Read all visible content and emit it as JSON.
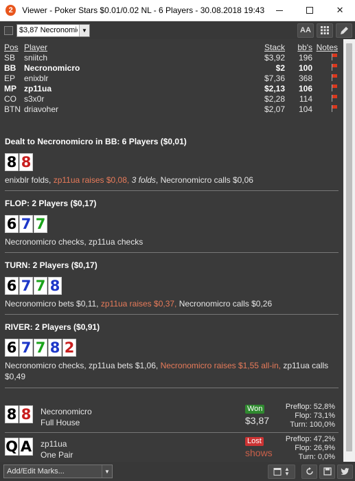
{
  "window": {
    "title": "Viewer - Poker Stars $0.01/0.02 NL - 6 Players - 30.08.2018 19:43",
    "app_icon_glyph": "2",
    "min_label": "",
    "max_label": "",
    "close_label": "✕"
  },
  "toolbar": {
    "hand_select_value": "$3,87 Necronomicro",
    "font_button": "AA",
    "grid_icon": "grid-icon",
    "edit_icon": "pencil-icon"
  },
  "players_table": {
    "headers": {
      "pos": "Pos",
      "player": "Player",
      "stack": "Stack",
      "bbs": "bb's",
      "notes": "Notes"
    },
    "rows": [
      {
        "pos": "SB",
        "player": "sniitch",
        "stack": "$3,92",
        "bbs": "196"
      },
      {
        "pos": "BB",
        "player": "Necronomicro",
        "stack": "$2",
        "bbs": "100"
      },
      {
        "pos": "EP",
        "player": "enixblr",
        "stack": "$7,36",
        "bbs": "368"
      },
      {
        "pos": "MP",
        "player": "zp11ua",
        "stack": "$2,13",
        "bbs": "106"
      },
      {
        "pos": "CO",
        "player": "s3x0r",
        "stack": "$2,28",
        "bbs": "114"
      },
      {
        "pos": "BTN",
        "player": "driaνoher",
        "stack": "$2,07",
        "bbs": "104"
      }
    ]
  },
  "preflop": {
    "title": "Dealt to Necronomicro in BB: 6 Players ($0,01)",
    "cards": [
      "8",
      "8"
    ],
    "action_1": "enixblr folds, ",
    "action_2": "zp11ua raises $0,08, ",
    "action_3": "3 folds",
    "action_4": ", Necronomicro calls $0,06"
  },
  "flop": {
    "title": "FLOP: 2 Players ($0,17)",
    "cards": [
      "6",
      "7",
      "7"
    ],
    "action": "Necronomicro checks, zp11ua checks"
  },
  "turn": {
    "title": "TURN: 2 Players ($0,17)",
    "cards": [
      "6",
      "7",
      "7",
      "8"
    ],
    "action_1": "Necronomicro bets $0,11, ",
    "action_2": "zp11ua raises $0,37, ",
    "action_3": "Necronomicro calls $0,26"
  },
  "river": {
    "title": "RIVER: 2 Players ($0,91)",
    "cards": [
      "6",
      "7",
      "7",
      "8",
      "2"
    ],
    "action_1": "Necronomicro checks, zp11ua bets $1,06, ",
    "action_2": "Necronomicro raises $1,55 all-in, ",
    "action_3": "zp11ua calls",
    "action_4": "$0,49"
  },
  "results": [
    {
      "cards": [
        "8",
        "8"
      ],
      "name": "Necronomicro",
      "hand": "Full House",
      "badge": "Won",
      "amount": "$3,87",
      "preflop_label": "Preflop:",
      "preflop": "52,8%",
      "flop_label": "Flop:",
      "flop": "73,1%",
      "turn_label": "Turn:",
      "turn": "100,0%"
    },
    {
      "cards": [
        "Q",
        "A"
      ],
      "name": "zp11ua",
      "hand": "One Pair",
      "badge": "Lost",
      "amount": "shows",
      "preflop_label": "Preflop:",
      "preflop": "47,2%",
      "flop_label": "Flop:",
      "flop": "26,9%",
      "turn_label": "Turn:",
      "turn": "0,0%"
    }
  ],
  "statusbar": {
    "marks_select": "Add/Edit Marks...",
    "icons": [
      "calendar-icon",
      "refresh-icon",
      "save-icon",
      "twitter-icon"
    ]
  },
  "colors": {
    "content_bg": "#3a3a3a",
    "raise_text": "#e87b5a",
    "won_badge": "#2f8a2f",
    "lost_badge": "#cc3333",
    "spade": "#000000",
    "heart": "#c81e1e",
    "club": "#1aa31a",
    "diamond": "#1d37c8"
  }
}
